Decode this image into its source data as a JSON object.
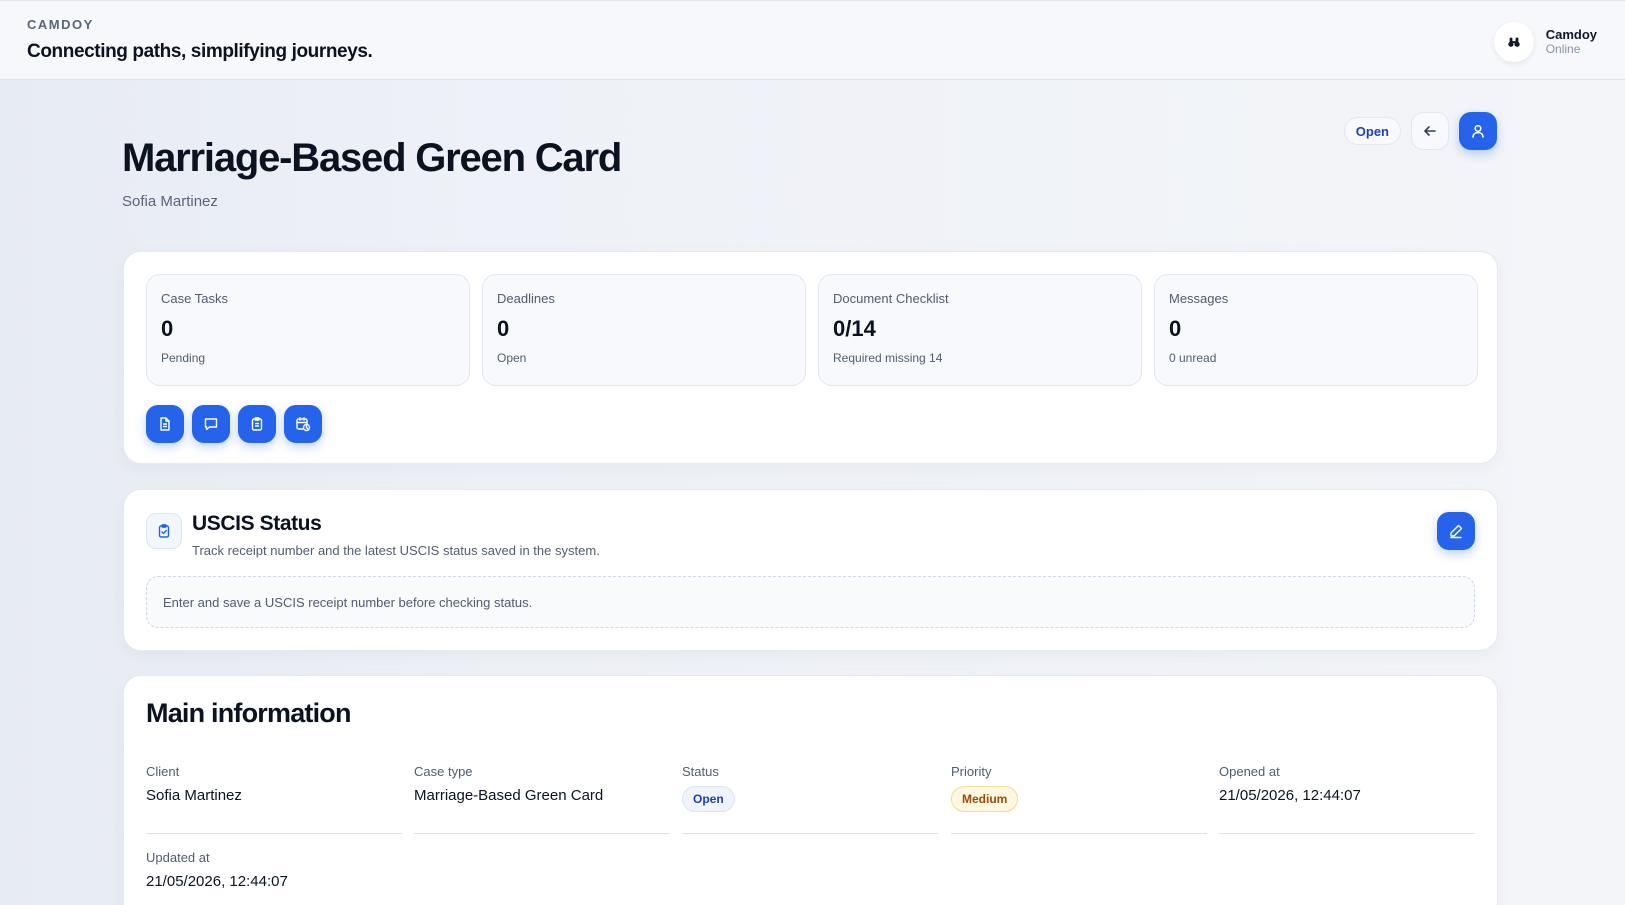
{
  "header": {
    "brand": "CAMDOY",
    "tagline": "Connecting paths, simplifying journeys.",
    "user": {
      "name": "Camdoy",
      "status": "Online",
      "icon": "binoculars-icon"
    }
  },
  "page": {
    "title": "Marriage-Based Green Card",
    "subtitle": "Sofia Martinez",
    "status_pill": "Open",
    "actions": {
      "back_icon": "arrow-left-icon",
      "profile_icon": "user-icon"
    }
  },
  "stats": [
    {
      "label": "Case Tasks",
      "value": "0",
      "sub": "Pending"
    },
    {
      "label": "Deadlines",
      "value": "0",
      "sub": "Open"
    },
    {
      "label": "Document Checklist",
      "value": "0/14",
      "sub": "Required missing 14"
    },
    {
      "label": "Messages",
      "value": "0",
      "sub": "0 unread"
    }
  ],
  "quick_actions": [
    {
      "icon": "document-icon"
    },
    {
      "icon": "chat-icon"
    },
    {
      "icon": "clipboard-icon"
    },
    {
      "icon": "calendar-clock-icon"
    }
  ],
  "uscis": {
    "title": "USCIS Status",
    "description": "Track receipt number and the latest USCIS status saved in the system.",
    "note": "Enter and save a USCIS receipt number before checking status.",
    "icon": "clipboard-check-icon",
    "edit_icon": "pencil-icon"
  },
  "main_info": {
    "title": "Main information",
    "fields": {
      "client": {
        "label": "Client",
        "value": "Sofia Martinez"
      },
      "case_type": {
        "label": "Case type",
        "value": "Marriage-Based Green Card"
      },
      "status": {
        "label": "Status",
        "value": "Open"
      },
      "priority": {
        "label": "Priority",
        "value": "Medium"
      },
      "opened_at": {
        "label": "Opened at",
        "value": "21/05/2026, 12:44:07"
      },
      "updated_at": {
        "label": "Updated at",
        "value": "21/05/2026, 12:44:07"
      }
    }
  },
  "colors": {
    "accent": "#2563eb",
    "text": "#0b1220",
    "muted": "#525c6e",
    "badge_open": "#1e40af",
    "badge_medium": "#9a4a06"
  }
}
